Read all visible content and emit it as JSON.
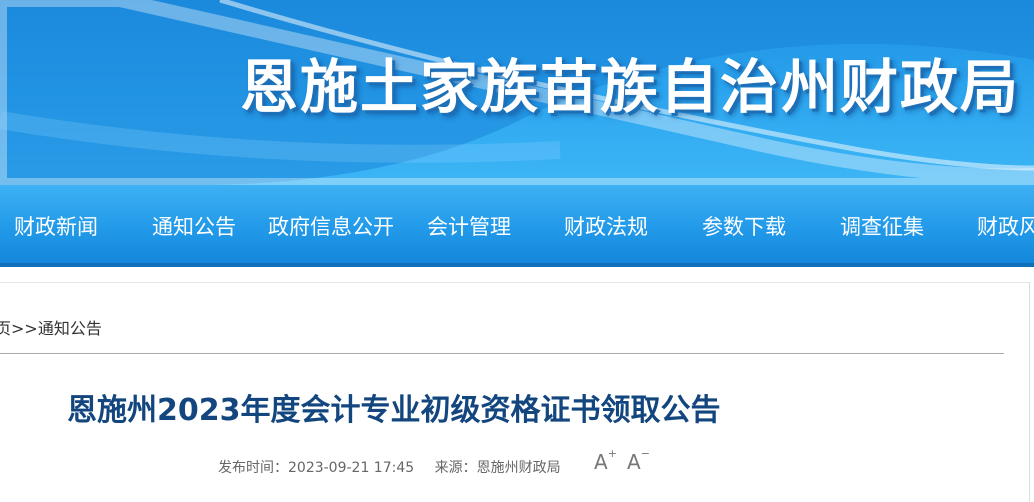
{
  "banner": {
    "title": "恩施土家族苗族自治州财政局"
  },
  "nav": {
    "items": [
      {
        "label": "财政新闻"
      },
      {
        "label": "通知公告"
      },
      {
        "label": "政府信息公开"
      },
      {
        "label": "会计管理"
      },
      {
        "label": "财政法规"
      },
      {
        "label": "参数下载"
      },
      {
        "label": "调查征集"
      },
      {
        "label": "财政风"
      }
    ]
  },
  "breadcrumb": {
    "home": "页",
    "separator": ">>",
    "current": "通知公告"
  },
  "article": {
    "title": "恩施州2023年度会计专业初级资格证书领取公告",
    "published": "发布时间：2023-09-21 17:45",
    "source": "来源：恩施州财政局"
  },
  "font_controls": {
    "increase": "A",
    "increase_mark": "+",
    "decrease": "A",
    "decrease_mark": "−"
  },
  "colors": {
    "banner_blue": "#2aa3ee",
    "nav_blue": "#229ae9",
    "title_navy": "#13467f"
  }
}
